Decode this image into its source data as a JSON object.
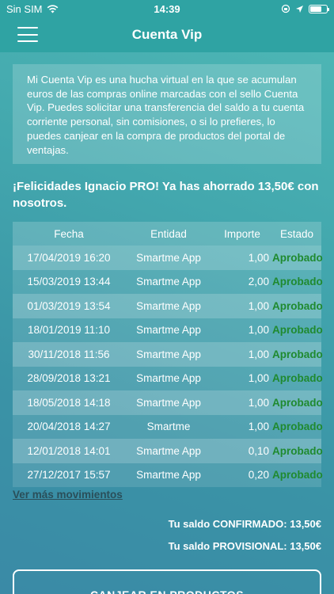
{
  "status_bar": {
    "carrier": "Sin SIM",
    "time": "14:39",
    "icons": [
      "wifi-icon",
      "orientation-lock-icon",
      "location-arrow-icon",
      "battery-icon"
    ]
  },
  "nav": {
    "title": "Cuenta Vip",
    "menu_icon": "hamburger-menu-icon"
  },
  "info": {
    "text": "Mi Cuenta Vip es una hucha virtual en la que se acumulan euros de las compras online marcadas con el sello Cuenta Vip. Puedes solicitar una transferencia del saldo a tu cuenta corriente personal, sin comisiones, o si lo prefieres, lo puedes canjear en la compra de productos del portal de ventajas."
  },
  "congrats": "¡Felicidades Ignacio PRO! Ya has ahorrado 13,50€ con nosotros.",
  "table": {
    "headers": {
      "fecha": "Fecha",
      "entidad": "Entidad",
      "importe": "Importe",
      "estado": "Estado"
    },
    "rows": [
      {
        "fecha": "17/04/2019 16:20",
        "entidad": "Smartme App",
        "importe": "1,00",
        "estado": "Aprobado"
      },
      {
        "fecha": "15/03/2019 13:44",
        "entidad": "Smartme App",
        "importe": "2,00",
        "estado": "Aprobado"
      },
      {
        "fecha": "01/03/2019 13:54",
        "entidad": "Smartme App",
        "importe": "1,00",
        "estado": "Aprobado"
      },
      {
        "fecha": "18/01/2019 11:10",
        "entidad": "Smartme App",
        "importe": "1,00",
        "estado": "Aprobado"
      },
      {
        "fecha": "30/11/2018 11:56",
        "entidad": "Smartme App",
        "importe": "1,00",
        "estado": "Aprobado"
      },
      {
        "fecha": "28/09/2018 13:21",
        "entidad": "Smartme App",
        "importe": "1,00",
        "estado": "Aprobado"
      },
      {
        "fecha": "18/05/2018 14:18",
        "entidad": "Smartme App",
        "importe": "1,00",
        "estado": "Aprobado"
      },
      {
        "fecha": "20/04/2018 14:27",
        "entidad": "Smartme",
        "importe": "1,00",
        "estado": "Aprobado"
      },
      {
        "fecha": "12/01/2018 14:01",
        "entidad": "Smartme App",
        "importe": "0,10",
        "estado": "Aprobado"
      },
      {
        "fecha": "27/12/2017 15:57",
        "entidad": "Smartme App",
        "importe": "0,20",
        "estado": "Aprobado"
      }
    ]
  },
  "more_link": "Ver más movimientos",
  "saldo": {
    "confirmado": "Tu saldo CONFIRMADO: 13,50€",
    "provisional": "Tu saldo PROVISIONAL: 13,50€"
  },
  "button_canjear": "CANJEAR EN PRODUCTOS",
  "colors": {
    "header": "#2fa3a3",
    "approved": "#1f8a2f",
    "link": "#2a4f5a"
  }
}
